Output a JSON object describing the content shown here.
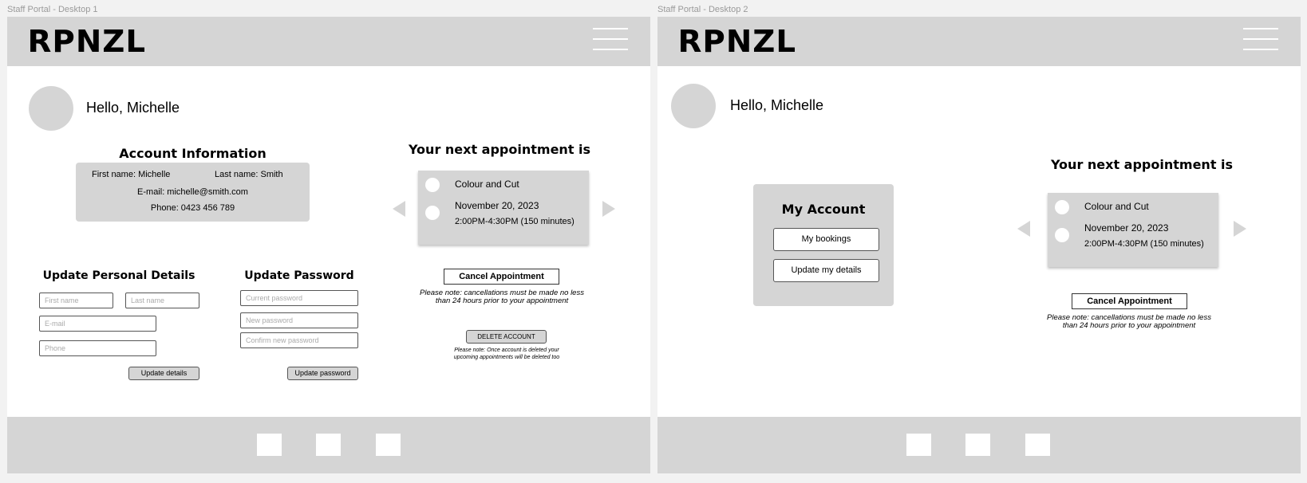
{
  "frames": [
    {
      "label": "Staff Portal - Desktop 1"
    },
    {
      "label": "Staff Portal - Desktop 2"
    }
  ],
  "header": {
    "logo": "RPNZL",
    "menu_icon": "hamburger-icon"
  },
  "greeting": "Hello, Michelle",
  "account_info": {
    "title": "Account Information",
    "first_name": "First name: Michelle",
    "last_name": "Last name: Smith",
    "email": "E-mail: michelle@smith.com",
    "phone": "Phone: 0423 456 789"
  },
  "personal_details": {
    "title": "Update Personal Details",
    "first_name_placeholder": "First name",
    "last_name_placeholder": "Last name",
    "email_placeholder": "E-mail",
    "phone_placeholder": "Phone",
    "button": "Update details"
  },
  "password": {
    "title": "Update Password",
    "current_placeholder": "Current password",
    "new_placeholder": "New password",
    "confirm_placeholder": "Confirm new password",
    "button": "Update password"
  },
  "appointment": {
    "title": "Your next appointment is",
    "service": "Colour and Cut",
    "date": "November 20, 2023",
    "time": "2:00PM-4:30PM (150 minutes)",
    "cancel_button": "Cancel Appointment",
    "cancel_note_line1": "Please note: cancellations must be made no less",
    "cancel_note_line2": "than 24 hours prior to your appointment"
  },
  "delete_account": {
    "button": "DELETE ACCOUNT",
    "note_line1": "Please note: Once account is deleted your",
    "note_line2": "upcoming appointments will be deleted too"
  },
  "my_account": {
    "title": "My Account",
    "bookings_button": "My bookings",
    "update_button": "Update my details"
  },
  "colors": {
    "panel_gray": "#d5d5d5",
    "page_bg": "#f2f2f2",
    "frame_bg": "#ffffff"
  }
}
